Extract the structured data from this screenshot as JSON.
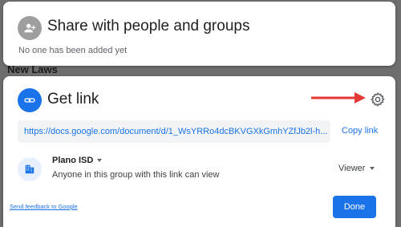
{
  "background": {
    "heading": "New Laws"
  },
  "share_panel": {
    "title": "Share with people and groups",
    "empty_message": "No one has been added yet",
    "icon": "person-add-icon"
  },
  "link_panel": {
    "title": "Get link",
    "icon": "link-icon",
    "settings_icon": "gear-icon",
    "url": "https://docs.google.com/document/d/1_WsYRRo4dcBKVGXkGmhYZfJb2l-h...",
    "copy_label": "Copy link",
    "access": {
      "org_name": "Plano ISD",
      "description": "Anyone in this group with this link can view",
      "role": "Viewer",
      "icon": "domain-icon"
    },
    "feedback_label": "Send feedback to Google",
    "done_label": "Done"
  },
  "colors": {
    "accent": "#1a73e8",
    "annotation_arrow": "#e53935"
  }
}
